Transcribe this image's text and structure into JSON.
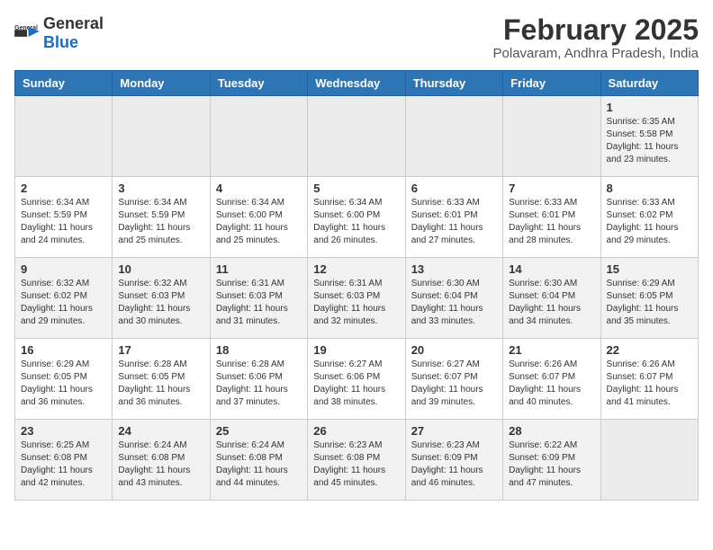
{
  "logo": {
    "general": "General",
    "blue": "Blue"
  },
  "title": "February 2025",
  "subtitle": "Polavaram, Andhra Pradesh, India",
  "weekdays": [
    "Sunday",
    "Monday",
    "Tuesday",
    "Wednesday",
    "Thursday",
    "Friday",
    "Saturday"
  ],
  "weeks": [
    [
      {
        "day": "",
        "info": ""
      },
      {
        "day": "",
        "info": ""
      },
      {
        "day": "",
        "info": ""
      },
      {
        "day": "",
        "info": ""
      },
      {
        "day": "",
        "info": ""
      },
      {
        "day": "",
        "info": ""
      },
      {
        "day": "1",
        "info": "Sunrise: 6:35 AM\nSunset: 5:58 PM\nDaylight: 11 hours and 23 minutes."
      }
    ],
    [
      {
        "day": "2",
        "info": "Sunrise: 6:34 AM\nSunset: 5:59 PM\nDaylight: 11 hours and 24 minutes."
      },
      {
        "day": "3",
        "info": "Sunrise: 6:34 AM\nSunset: 5:59 PM\nDaylight: 11 hours and 25 minutes."
      },
      {
        "day": "4",
        "info": "Sunrise: 6:34 AM\nSunset: 6:00 PM\nDaylight: 11 hours and 25 minutes."
      },
      {
        "day": "5",
        "info": "Sunrise: 6:34 AM\nSunset: 6:00 PM\nDaylight: 11 hours and 26 minutes."
      },
      {
        "day": "6",
        "info": "Sunrise: 6:33 AM\nSunset: 6:01 PM\nDaylight: 11 hours and 27 minutes."
      },
      {
        "day": "7",
        "info": "Sunrise: 6:33 AM\nSunset: 6:01 PM\nDaylight: 11 hours and 28 minutes."
      },
      {
        "day": "8",
        "info": "Sunrise: 6:33 AM\nSunset: 6:02 PM\nDaylight: 11 hours and 29 minutes."
      }
    ],
    [
      {
        "day": "9",
        "info": "Sunrise: 6:32 AM\nSunset: 6:02 PM\nDaylight: 11 hours and 29 minutes."
      },
      {
        "day": "10",
        "info": "Sunrise: 6:32 AM\nSunset: 6:03 PM\nDaylight: 11 hours and 30 minutes."
      },
      {
        "day": "11",
        "info": "Sunrise: 6:31 AM\nSunset: 6:03 PM\nDaylight: 11 hours and 31 minutes."
      },
      {
        "day": "12",
        "info": "Sunrise: 6:31 AM\nSunset: 6:03 PM\nDaylight: 11 hours and 32 minutes."
      },
      {
        "day": "13",
        "info": "Sunrise: 6:30 AM\nSunset: 6:04 PM\nDaylight: 11 hours and 33 minutes."
      },
      {
        "day": "14",
        "info": "Sunrise: 6:30 AM\nSunset: 6:04 PM\nDaylight: 11 hours and 34 minutes."
      },
      {
        "day": "15",
        "info": "Sunrise: 6:29 AM\nSunset: 6:05 PM\nDaylight: 11 hours and 35 minutes."
      }
    ],
    [
      {
        "day": "16",
        "info": "Sunrise: 6:29 AM\nSunset: 6:05 PM\nDaylight: 11 hours and 36 minutes."
      },
      {
        "day": "17",
        "info": "Sunrise: 6:28 AM\nSunset: 6:05 PM\nDaylight: 11 hours and 36 minutes."
      },
      {
        "day": "18",
        "info": "Sunrise: 6:28 AM\nSunset: 6:06 PM\nDaylight: 11 hours and 37 minutes."
      },
      {
        "day": "19",
        "info": "Sunrise: 6:27 AM\nSunset: 6:06 PM\nDaylight: 11 hours and 38 minutes."
      },
      {
        "day": "20",
        "info": "Sunrise: 6:27 AM\nSunset: 6:07 PM\nDaylight: 11 hours and 39 minutes."
      },
      {
        "day": "21",
        "info": "Sunrise: 6:26 AM\nSunset: 6:07 PM\nDaylight: 11 hours and 40 minutes."
      },
      {
        "day": "22",
        "info": "Sunrise: 6:26 AM\nSunset: 6:07 PM\nDaylight: 11 hours and 41 minutes."
      }
    ],
    [
      {
        "day": "23",
        "info": "Sunrise: 6:25 AM\nSunset: 6:08 PM\nDaylight: 11 hours and 42 minutes."
      },
      {
        "day": "24",
        "info": "Sunrise: 6:24 AM\nSunset: 6:08 PM\nDaylight: 11 hours and 43 minutes."
      },
      {
        "day": "25",
        "info": "Sunrise: 6:24 AM\nSunset: 6:08 PM\nDaylight: 11 hours and 44 minutes."
      },
      {
        "day": "26",
        "info": "Sunrise: 6:23 AM\nSunset: 6:08 PM\nDaylight: 11 hours and 45 minutes."
      },
      {
        "day": "27",
        "info": "Sunrise: 6:23 AM\nSunset: 6:09 PM\nDaylight: 11 hours and 46 minutes."
      },
      {
        "day": "28",
        "info": "Sunrise: 6:22 AM\nSunset: 6:09 PM\nDaylight: 11 hours and 47 minutes."
      },
      {
        "day": "",
        "info": ""
      }
    ]
  ]
}
